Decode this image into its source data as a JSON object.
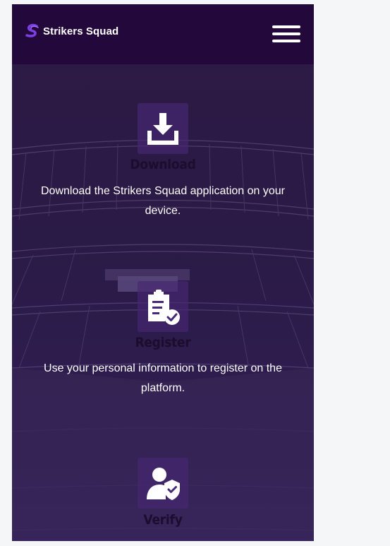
{
  "header": {
    "brand_name": "Strikers Squad",
    "logo_letter": "S",
    "menu_icon": "hamburger-menu-icon"
  },
  "colors": {
    "header_bg": "#23093b",
    "page_bg": "#2d1b45",
    "icon_tile": "#46287",
    "title_text": "#1c0c2e",
    "body_text": "#ffffff",
    "logo_accent": "#7b3fe4"
  },
  "steps": [
    {
      "icon": "download-icon",
      "title": "Download",
      "description": "Download the Strikers Squad application on your device."
    },
    {
      "icon": "clipboard-check-icon",
      "title": "Register",
      "description": "Use your personal information to register on the platform."
    },
    {
      "icon": "user-shield-icon",
      "title": "Verify",
      "description": ""
    }
  ]
}
